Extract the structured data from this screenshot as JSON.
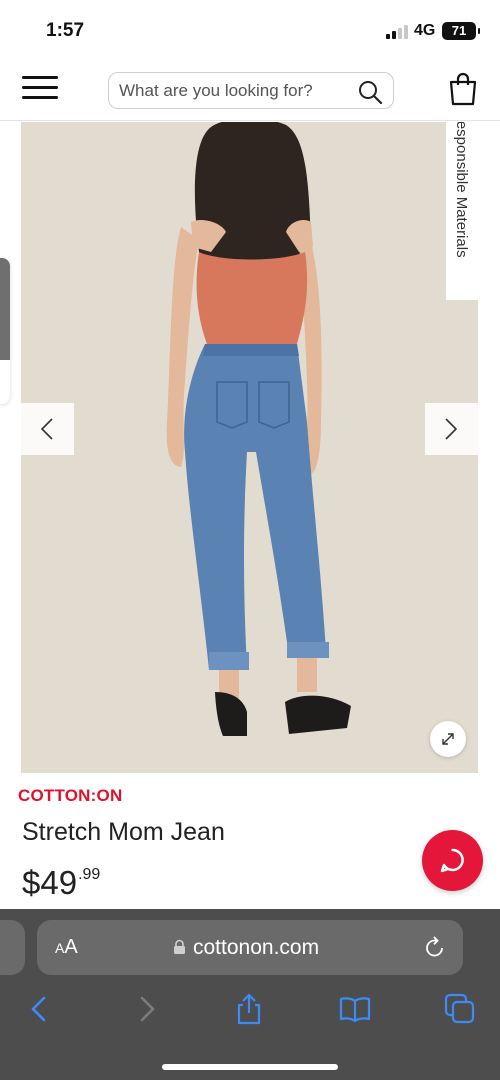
{
  "status_bar": {
    "time": "1:57",
    "network": "4G",
    "battery": "71"
  },
  "header": {
    "menu_icon": "hamburger-menu-icon",
    "search": {
      "placeholder": "What are you looking for?",
      "value": ""
    },
    "search_icon": "search-icon",
    "cart_icon": "shopping-bag-icon"
  },
  "gallery": {
    "badge": "Responsible Materials",
    "prev_icon": "chevron-left-icon",
    "next_icon": "chevron-right-icon",
    "expand_icon": "expand-icon"
  },
  "product": {
    "brand": "COTTON:ON",
    "name": "Stretch Mom Jean",
    "price_dollars": "$49",
    "price_cents": ".99"
  },
  "safari": {
    "aa_small": "A",
    "aa_large": "A",
    "url": "cottonon.com",
    "toolbar": [
      "back-icon",
      "forward-icon",
      "share-icon",
      "bookmarks-icon",
      "tabs-icon"
    ]
  },
  "colors": {
    "brand_red": "#e0112b",
    "chat_red": "#e4173a",
    "safari_bg": "#4d4d4d",
    "link_blue": "#3b8cf7"
  }
}
